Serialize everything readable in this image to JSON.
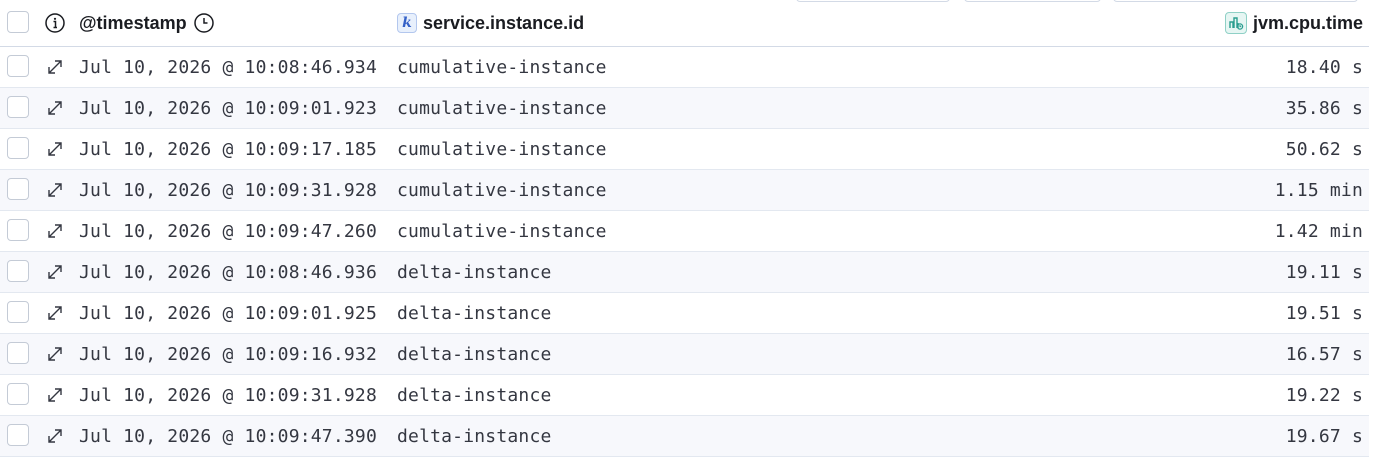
{
  "header": {
    "timestamp_label": "@timestamp",
    "service_label": "service.instance.id",
    "cpu_label": "jvm.cpu.time",
    "service_type_token": "k",
    "icons": [
      "info-icon",
      "clock-icon",
      "keyword-type-icon",
      "number-type-icon"
    ]
  },
  "rows": [
    {
      "timestamp": "Jul 10, 2026 @ 10:08:46.934",
      "service": "cumulative-instance",
      "cpu": "18.40 s"
    },
    {
      "timestamp": "Jul 10, 2026 @ 10:09:01.923",
      "service": "cumulative-instance",
      "cpu": "35.86 s"
    },
    {
      "timestamp": "Jul 10, 2026 @ 10:09:17.185",
      "service": "cumulative-instance",
      "cpu": "50.62 s"
    },
    {
      "timestamp": "Jul 10, 2026 @ 10:09:31.928",
      "service": "cumulative-instance",
      "cpu": "1.15 min"
    },
    {
      "timestamp": "Jul 10, 2026 @ 10:09:47.260",
      "service": "cumulative-instance",
      "cpu": "1.42 min"
    },
    {
      "timestamp": "Jul 10, 2026 @ 10:08:46.936",
      "service": "delta-instance",
      "cpu": "19.11 s"
    },
    {
      "timestamp": "Jul 10, 2026 @ 10:09:01.925",
      "service": "delta-instance",
      "cpu": "19.51 s"
    },
    {
      "timestamp": "Jul 10, 2026 @ 10:09:16.932",
      "service": "delta-instance",
      "cpu": "16.57 s"
    },
    {
      "timestamp": "Jul 10, 2026 @ 10:09:31.928",
      "service": "delta-instance",
      "cpu": "19.22 s"
    },
    {
      "timestamp": "Jul 10, 2026 @ 10:09:47.390",
      "service": "delta-instance",
      "cpu": "19.67 s"
    }
  ],
  "row_icon": "expand-icon",
  "colors": {
    "border": "#d3dae6",
    "alt_row": "#f7f8fc",
    "keyword_token": "#3561c7",
    "number_token": "#2a9d8f"
  }
}
